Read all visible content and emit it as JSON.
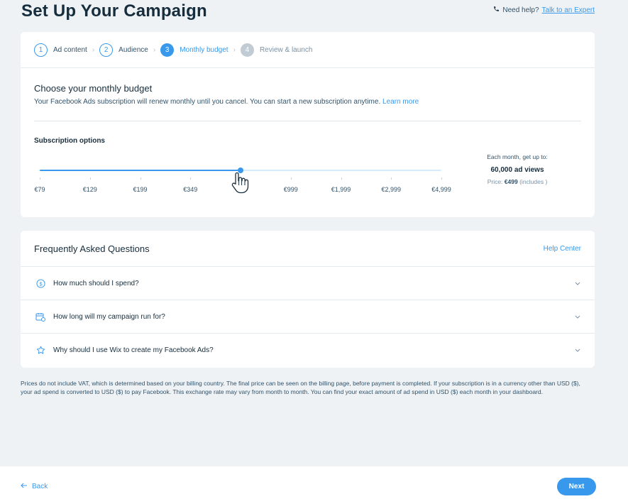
{
  "page": {
    "title": "Set Up Your Campaign"
  },
  "help": {
    "prefix": "Need help?",
    "link": "Talk to an Expert",
    "icon": "phone-icon"
  },
  "stepper": {
    "steps": [
      {
        "number": "1",
        "label": "Ad content",
        "state": "done"
      },
      {
        "number": "2",
        "label": "Audience",
        "state": "done"
      },
      {
        "number": "3",
        "label": "Monthly budget",
        "state": "active"
      },
      {
        "number": "4",
        "label": "Review & launch",
        "state": "pending"
      }
    ]
  },
  "budget": {
    "title": "Choose your monthly budget",
    "description": "Your Facebook Ads subscription will renew monthly until you cancel. You can start a new subscription anytime.",
    "learn_more": "Learn more",
    "subscription_label": "Subscription options",
    "slider": {
      "options": [
        "€79",
        "€129",
        "€199",
        "€349",
        "€499",
        "€999",
        "€1,999",
        "€2,999",
        "€4,999"
      ],
      "selected_index": 4,
      "selected_value": "€499"
    },
    "info": {
      "headline": "Each month, get up to:",
      "views": "60,000 ad views",
      "price_label": "Price:",
      "price_value": "€499",
      "price_suffix": "(includes )"
    }
  },
  "faq": {
    "title": "Frequently Asked Questions",
    "help_center": "Help Center",
    "items": [
      {
        "question": "How much should I spend?",
        "icon": "dollar-circle-icon"
      },
      {
        "question": "How long will my campaign run for?",
        "icon": "calendar-icon"
      },
      {
        "question": "Why should I use Wix to create my Facebook Ads?",
        "icon": "star-icon"
      }
    ]
  },
  "disclaimer": "Prices do not include VAT, which is determined based on your billing country. The final price can be seen on the billing page, before payment is completed. If your subscription is in a currency other than USD ($), your ad spend is converted to USD ($) to pay Facebook. This exchange rate may vary from month to month. You can find your exact amount of ad spend in USD ($) each month in your dashboard.",
  "footer": {
    "back": "Back",
    "next": "Next"
  },
  "colors": {
    "accent": "#3899ec",
    "text": "#162d3d",
    "background": "#eef2f5"
  }
}
